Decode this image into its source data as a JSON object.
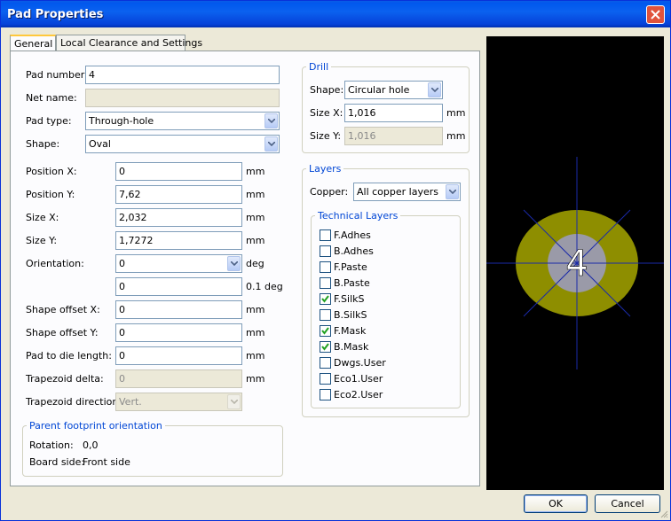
{
  "window": {
    "title": "Pad Properties"
  },
  "tabs": [
    {
      "label": "General",
      "active": true
    },
    {
      "label": "Local Clearance and Settings",
      "active": false
    }
  ],
  "general": {
    "pad_number": {
      "label": "Pad number:",
      "value": "4"
    },
    "net_name": {
      "label": "Net name:",
      "value": ""
    },
    "pad_type": {
      "label": "Pad type:",
      "value": "Through-hole"
    },
    "shape": {
      "label": "Shape:",
      "value": "Oval"
    },
    "position_x": {
      "label": "Position X:",
      "value": "0",
      "unit": "mm"
    },
    "position_y": {
      "label": "Position Y:",
      "value": "7,62",
      "unit": "mm"
    },
    "size_x": {
      "label": "Size X:",
      "value": "2,032",
      "unit": "mm"
    },
    "size_y": {
      "label": "Size Y:",
      "value": "1,7272",
      "unit": "mm"
    },
    "orientation": {
      "label": "Orientation:",
      "value": "0",
      "unit": "deg"
    },
    "orientation_custom": {
      "value": "0",
      "unit": "0.1 deg"
    },
    "shape_offset_x": {
      "label": "Shape offset X:",
      "value": "0",
      "unit": "mm"
    },
    "shape_offset_y": {
      "label": "Shape offset Y:",
      "value": "0",
      "unit": "mm"
    },
    "pad_to_die": {
      "label": "Pad to die length:",
      "value": "0",
      "unit": "mm"
    },
    "trapezoid_delta": {
      "label": "Trapezoid delta:",
      "value": "0",
      "unit": "mm"
    },
    "trapezoid_direction": {
      "label": "Trapezoid direction:",
      "value": "Vert."
    }
  },
  "parent": {
    "title": "Parent footprint orientation",
    "rotation_label": "Rotation:",
    "rotation_value": "0,0",
    "side_label": "Board side:",
    "side_value": "Front side"
  },
  "drill": {
    "title": "Drill",
    "shape_label": "Shape:",
    "shape_value": "Circular hole",
    "size_x_label": "Size X:",
    "size_x_value": "1,016",
    "size_x_unit": "mm",
    "size_y_label": "Size Y:",
    "size_y_value": "1,016",
    "size_y_unit": "mm"
  },
  "layers": {
    "title": "Layers",
    "copper_label": "Copper:",
    "copper_value": "All copper layers",
    "technical_title": "Technical Layers",
    "items": [
      {
        "label": "F.Adhes",
        "checked": false
      },
      {
        "label": "B.Adhes",
        "checked": false
      },
      {
        "label": "F.Paste",
        "checked": false
      },
      {
        "label": "B.Paste",
        "checked": false
      },
      {
        "label": "F.SilkS",
        "checked": true
      },
      {
        "label": "B.SilkS",
        "checked": false
      },
      {
        "label": "F.Mask",
        "checked": true
      },
      {
        "label": "B.Mask",
        "checked": true
      },
      {
        "label": "Dwgs.User",
        "checked": false
      },
      {
        "label": "Eco1.User",
        "checked": false
      },
      {
        "label": "Eco2.User",
        "checked": false
      }
    ]
  },
  "preview": {
    "pad_label": "4",
    "colors": {
      "background": "#000000",
      "pad": "#8e8e00",
      "hole": "#9a9aa8",
      "axis": "#1a2aa8",
      "label": "#ffffff"
    }
  },
  "buttons": {
    "ok": "OK",
    "cancel": "Cancel"
  }
}
